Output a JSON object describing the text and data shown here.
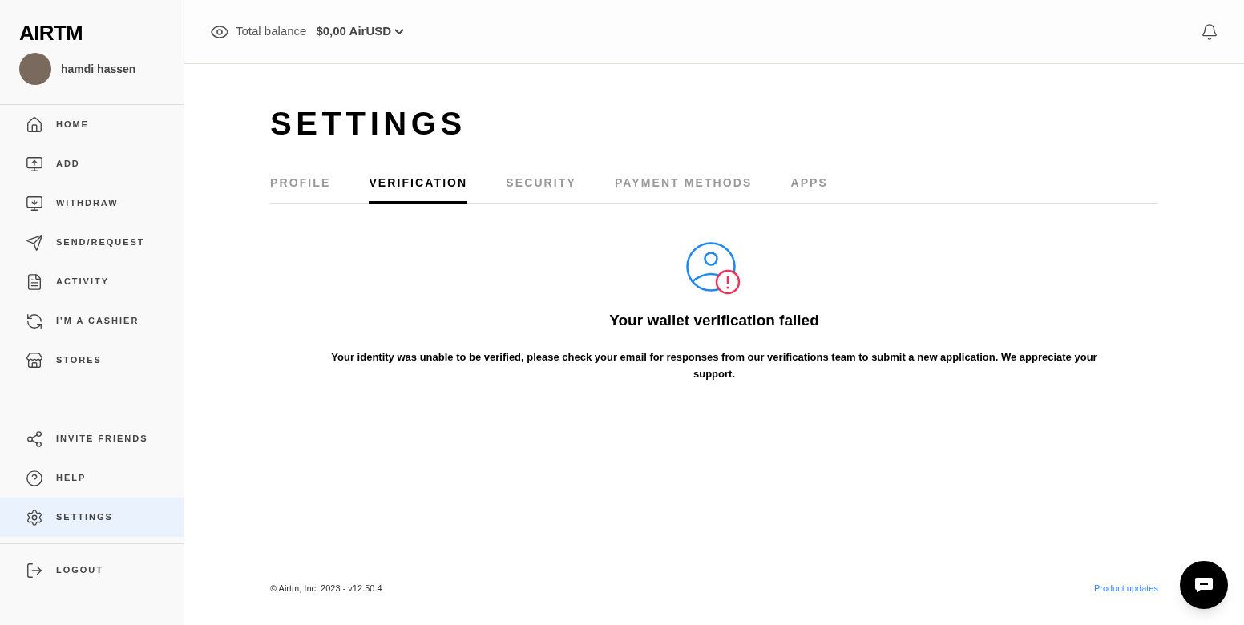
{
  "sidebar": {
    "logo": "AIRTM",
    "user": {
      "name": "hamdi hassen"
    },
    "main_items": [
      {
        "label": "HOME",
        "selected": false
      },
      {
        "label": "ADD",
        "selected": false
      },
      {
        "label": "WITHDRAW",
        "selected": false
      },
      {
        "label": "SEND/REQUEST",
        "selected": false
      },
      {
        "label": "ACTIVITY",
        "selected": false
      },
      {
        "label": "I'M A CASHIER",
        "selected": false
      },
      {
        "label": "STORES",
        "selected": false
      }
    ],
    "secondary_items": [
      {
        "label": "INVITE FRIENDS",
        "selected": false
      },
      {
        "label": "HELP",
        "selected": false
      },
      {
        "label": "SETTINGS",
        "selected": true
      }
    ],
    "logout": {
      "label": "LOGOUT"
    }
  },
  "header": {
    "balance_label": "Total balance",
    "balance_value": "$0,00 AirUSD"
  },
  "page": {
    "title": "SETTINGS",
    "tabs": [
      {
        "label": "PROFILE",
        "selected": false
      },
      {
        "label": "VERIFICATION",
        "selected": true
      },
      {
        "label": "SECURITY",
        "selected": false
      },
      {
        "label": "PAYMENT METHODS",
        "selected": false
      },
      {
        "label": "APPS",
        "selected": false
      }
    ],
    "status": {
      "heading": "Your wallet verification failed",
      "message": "Your identity was unable to be verified, please check your email for responses from our verifications team to submit a new application. We appreciate your support."
    }
  },
  "footer": {
    "copyright": "© Airtm, Inc. 2023 - v12.50.4",
    "link": "Product updates"
  }
}
